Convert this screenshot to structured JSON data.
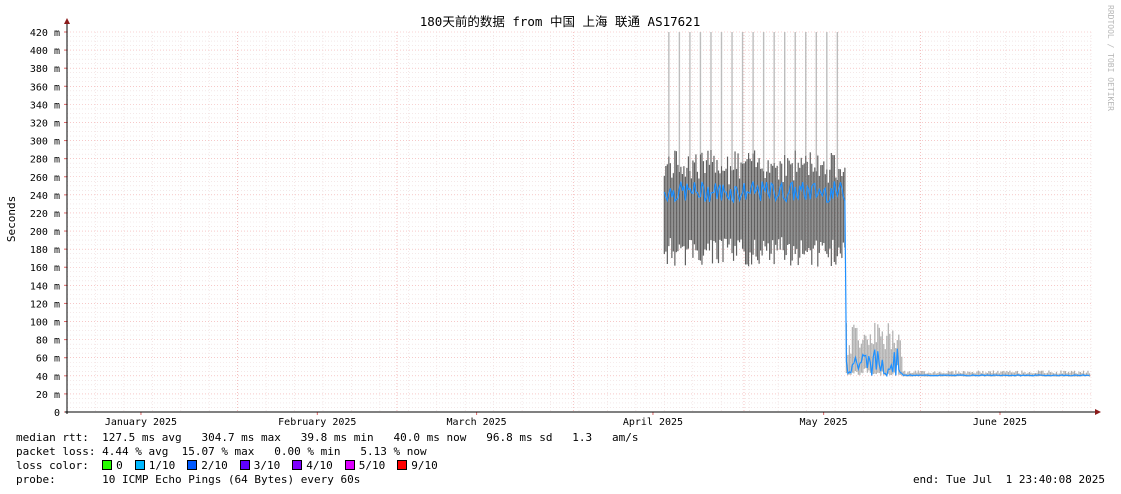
{
  "chart_data": {
    "type": "line",
    "title": "180天前的数据 from 中国 上海 联通 AS17621",
    "ylabel": "Seconds",
    "watermark": "RRDTOOL / TOBI OETIKER",
    "ylim": [
      0,
      420
    ],
    "y_ticks": [
      0,
      20,
      40,
      60,
      80,
      100,
      120,
      140,
      160,
      180,
      200,
      220,
      240,
      260,
      280,
      300,
      320,
      340,
      360,
      380,
      400,
      420
    ],
    "y_tick_labels": [
      "0",
      "20 m",
      "40 m",
      "60 m",
      "80 m",
      "100 m",
      "120 m",
      "140 m",
      "160 m",
      "180 m",
      "200 m",
      "220 m",
      "240 m",
      "260 m",
      "280 m",
      "300 m",
      "320 m",
      "340 m",
      "360 m",
      "380 m",
      "400 m",
      "420 m"
    ],
    "x_range": [
      "2025-01-02",
      "2025-07-01"
    ],
    "x_ticks": [
      {
        "date": "2025-01-15",
        "label": "January 2025"
      },
      {
        "date": "2025-02-15",
        "label": "February 2025"
      },
      {
        "date": "2025-03-15",
        "label": "March 2025"
      },
      {
        "date": "2025-04-15",
        "label": "April 2025"
      },
      {
        "date": "2025-05-15",
        "label": "May 2025"
      },
      {
        "date": "2025-06-15",
        "label": "June 2025"
      }
    ],
    "grid": true,
    "series": [
      {
        "name": "median rtt",
        "segments": [
          {
            "from": "2025-04-17",
            "to": "2025-05-19",
            "median_low": 232,
            "median_high": 255,
            "min": 160,
            "max": 290,
            "spike_max": 420
          },
          {
            "from": "2025-05-19",
            "to": "2025-05-29",
            "median_low": 40,
            "median_high": 70,
            "min": 40,
            "max": 100
          },
          {
            "from": "2025-05-29",
            "to": "2025-07-01",
            "median_low": 40,
            "median_high": 41,
            "min": 39,
            "max": 46
          }
        ]
      }
    ]
  },
  "stats": {
    "median_label": "median rtt:",
    "median_values": "127.5 ms avg   304.7 ms max   39.8 ms min   40.0 ms now   96.8 ms sd   1.3   am/s",
    "loss_label": "packet loss:",
    "loss_values": "4.44 % avg  15.07 % max   0.00 % min   5.13 % now",
    "loss_color_label": "loss color:",
    "loss_colors": [
      {
        "label": "0",
        "color": "#26ff00"
      },
      {
        "label": "1/10",
        "color": "#00b8ff"
      },
      {
        "label": "2/10",
        "color": "#0059ff"
      },
      {
        "label": "3/10",
        "color": "#5e00ff"
      },
      {
        "label": "4/10",
        "color": "#7e00ff"
      },
      {
        "label": "5/10",
        "color": "#dd00ff"
      },
      {
        "label": "9/10",
        "color": "#ff0000"
      }
    ],
    "probe_label": "probe:",
    "probe_value": "10 ICMP Echo Pings (64 Bytes) every 60s",
    "end_text": "end: Tue Jul  1 23:40:08 2025"
  }
}
